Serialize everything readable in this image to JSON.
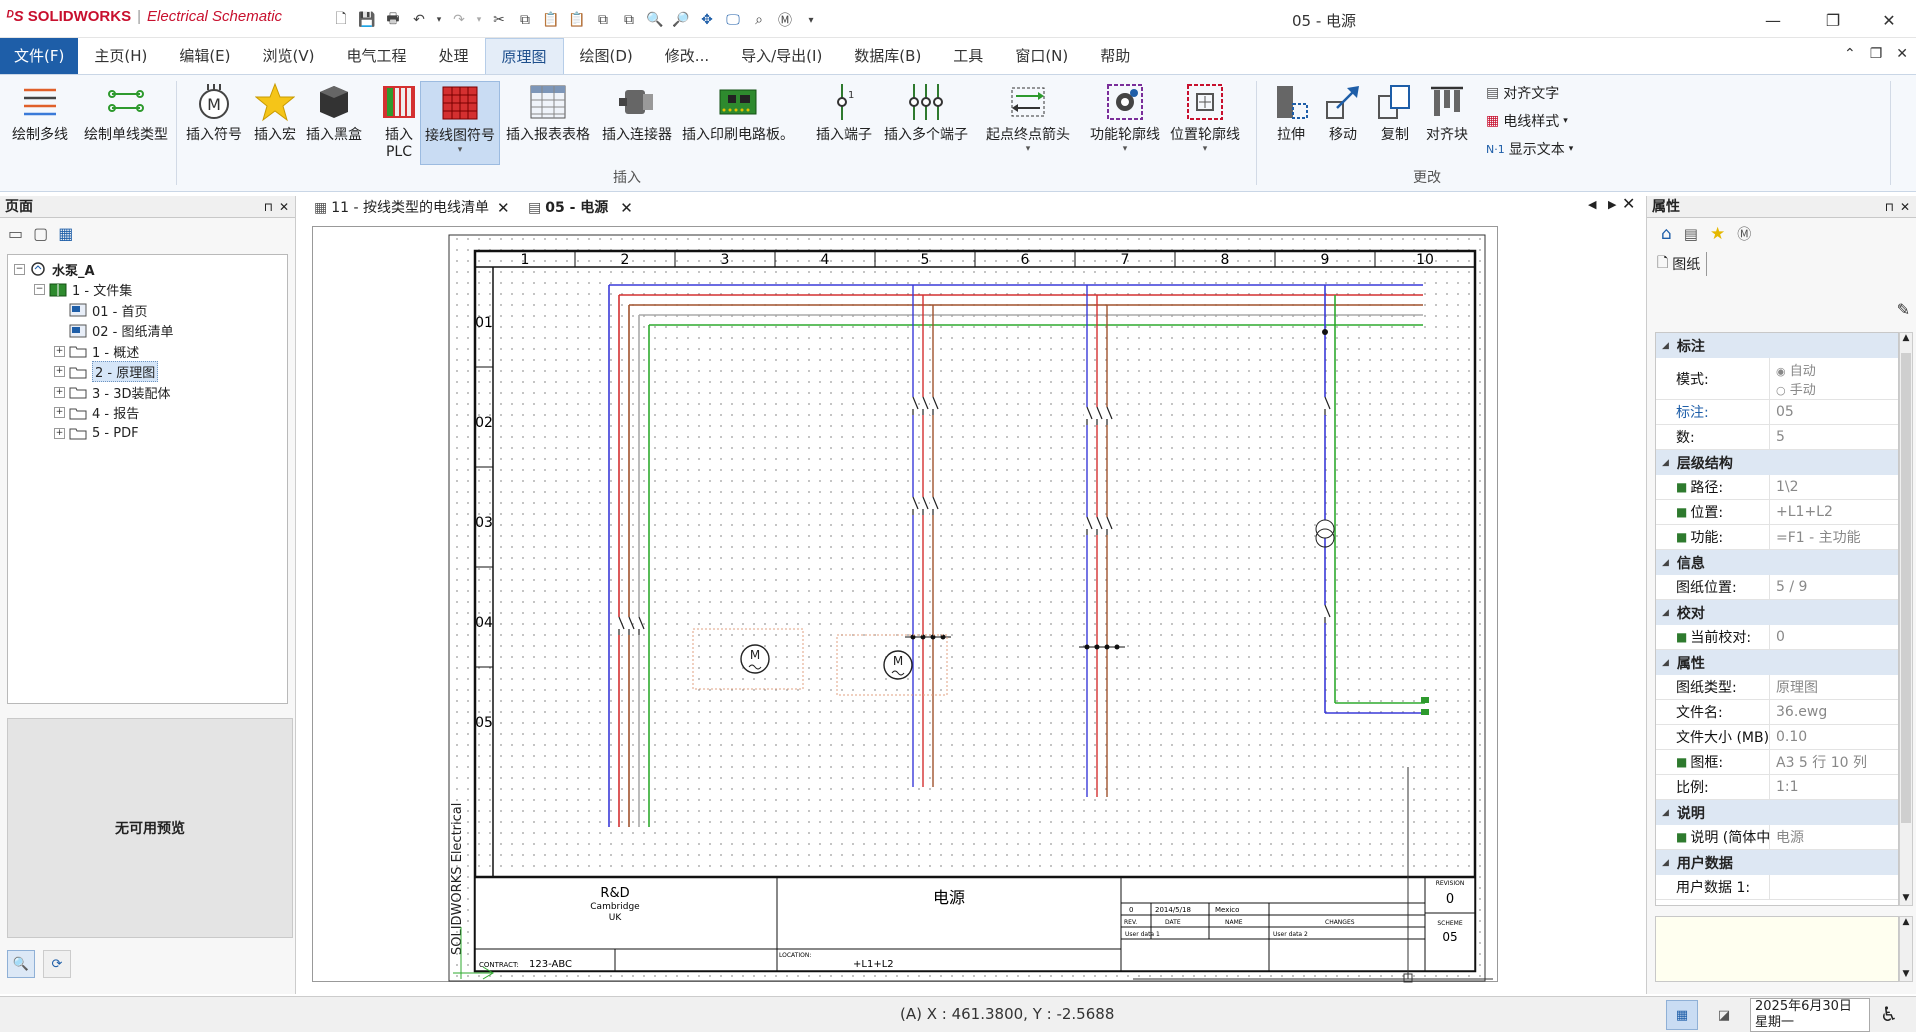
{
  "app": {
    "brand": "SOLIDWORKS",
    "product": "Electrical Schematic",
    "window_title": "05 - 电源"
  },
  "menu": {
    "items": [
      "文件(F)",
      "主页(H)",
      "编辑(E)",
      "浏览(V)",
      "电气工程",
      "处理",
      "原理图",
      "绘图(D)",
      "修改...",
      "导入/导出(I)",
      "数据库(B)",
      "工具",
      "窗口(N)",
      "帮助"
    ],
    "active_index": 6
  },
  "ribbon": {
    "buttons": [
      {
        "label": "绘制多线",
        "icon": "multiline-icon"
      },
      {
        "label": "绘制单线类型",
        "icon": "singleline-icon"
      },
      {
        "label": "插入符号",
        "icon": "motor-symbol-icon"
      },
      {
        "label": "插入宏",
        "icon": "macro-star-icon"
      },
      {
        "label": "插入黑盒",
        "icon": "black-box-icon"
      },
      {
        "label": "插入\nPLC",
        "icon": "plc-icon"
      },
      {
        "label": "接线图符号",
        "icon": "wiring-diagram-icon"
      },
      {
        "label": "插入报表表格",
        "icon": "report-table-icon"
      },
      {
        "label": "插入连接器",
        "icon": "connector-icon"
      },
      {
        "label": "插入印刷电路板。",
        "icon": "pcb-icon"
      },
      {
        "label": "插入端子",
        "icon": "terminal-icon"
      },
      {
        "label": "插入多个端子",
        "icon": "multi-terminal-icon"
      },
      {
        "label": "起点终点箭头",
        "icon": "origin-dest-arrow-icon"
      },
      {
        "label": "功能轮廓线",
        "icon": "function-outline-icon"
      },
      {
        "label": "位置轮廓线",
        "icon": "location-outline-icon"
      },
      {
        "label": "拉伸",
        "icon": "stretch-icon"
      },
      {
        "label": "移动",
        "icon": "move-icon"
      },
      {
        "label": "复制",
        "icon": "copy-icon"
      },
      {
        "label": "对齐块",
        "icon": "align-block-icon"
      }
    ],
    "small_buttons": [
      "对齐文字",
      "电线样式",
      "显示文本"
    ],
    "groups": [
      "插入",
      "更改"
    ]
  },
  "pages_panel": {
    "title": "页面",
    "tree": [
      {
        "label": "水泵_A",
        "level": 0,
        "toggle": "−"
      },
      {
        "label": "1 - 文件集",
        "level": 1,
        "toggle": "−"
      },
      {
        "label": "01 - 首页",
        "level": 2,
        "toggle": ""
      },
      {
        "label": "02 - 图纸清单",
        "level": 2,
        "toggle": ""
      },
      {
        "label": "1 - 概述",
        "level": 2,
        "toggle": "+"
      },
      {
        "label": "2 - 原理图",
        "level": 2,
        "toggle": "+",
        "selected": true
      },
      {
        "label": "3 - 3D装配体",
        "level": 2,
        "toggle": "+"
      },
      {
        "label": "4 - 报告",
        "level": 2,
        "toggle": "+"
      },
      {
        "label": "5 - PDF",
        "level": 2,
        "toggle": "+"
      }
    ],
    "preview_text": "无可用预览"
  },
  "doc_tabs": [
    {
      "label": "11 - 按线类型的电线清单",
      "active": false
    },
    {
      "label": "05 - 电源",
      "active": true
    }
  ],
  "drawing": {
    "columns": [
      "1",
      "2",
      "3",
      "4",
      "5",
      "6",
      "7",
      "8",
      "9",
      "10"
    ],
    "rows": [
      "01",
      "02",
      "03",
      "04",
      "05"
    ],
    "side_text": "SOLIDWORKS Electrical",
    "company": "R&D",
    "company_city": "Cambridge",
    "company_country": "UK",
    "sheet_title": "电源",
    "contract_label": "CONTRACT:",
    "contract": "123-ABC",
    "location_label": "LOCATION:",
    "location": "+L1+L2",
    "rev_label": "REVISION",
    "rev": "0",
    "scheme_label": "SCHEME",
    "scheme": "05",
    "rev_row": {
      "rev": "0",
      "date": "2014/5/18",
      "name": "Mexico"
    },
    "rev_headers": {
      "rev": "REV.",
      "date": "DATE",
      "name": "NAME",
      "changes": "CHANGES"
    },
    "user_data1": "User data 1",
    "user_data2": "User data 2",
    "motor_letter": "M"
  },
  "properties_panel": {
    "title": "属性",
    "tab": "图纸",
    "sections": [
      {
        "name": "标注",
        "rows": [
          {
            "key": "模式:",
            "value": "",
            "radio": [
              "自动",
              "手动"
            ]
          },
          {
            "key": "标注:",
            "value": "05",
            "key_link": true
          },
          {
            "key": "数:",
            "value": "5"
          }
        ]
      },
      {
        "name": "层级结构",
        "rows": [
          {
            "key": "路径:",
            "value": "1\\2",
            "icon": "book-icon"
          },
          {
            "key": "位置:",
            "value": "+L1+L2",
            "icon": "location-icon"
          },
          {
            "key": "功能:",
            "value": "=F1 - 主功能",
            "icon": "function-icon"
          }
        ]
      },
      {
        "name": "信息",
        "rows": [
          {
            "key": "图纸位置:",
            "value": "5 / 9"
          }
        ]
      },
      {
        "name": "校对",
        "rows": [
          {
            "key": "当前校对:",
            "value": "0",
            "icon": "revision-icon"
          }
        ]
      },
      {
        "name": "属性",
        "rows": [
          {
            "key": "图纸类型:",
            "value": "原理图"
          },
          {
            "key": "文件名:",
            "value": "36.ewg"
          },
          {
            "key": "文件大小 (MB):",
            "value": "0.10"
          },
          {
            "key": "图框:",
            "value": "A3 5 行 10 列",
            "icon": "frame-icon"
          },
          {
            "key": "比例:",
            "value": "1:1"
          }
        ]
      },
      {
        "name": "说明",
        "rows": [
          {
            "key": "说明 (简体中",
            "value": "电源",
            "icon": "description-icon"
          }
        ]
      },
      {
        "name": "用户数据",
        "rows": [
          {
            "key": "用户数据 1:",
            "value": ""
          }
        ]
      }
    ]
  },
  "status": {
    "coords": "(A) X : 461.3800, Y : -2.5688",
    "date": "2025年6月30日",
    "weekday": "星期一"
  },
  "colors": {
    "accent": "#1e5ea8",
    "wire_blue": "#3a3ad8",
    "wire_red": "#d43030",
    "wire_brown": "#a0522d",
    "wire_green": "#2eaa2e"
  }
}
